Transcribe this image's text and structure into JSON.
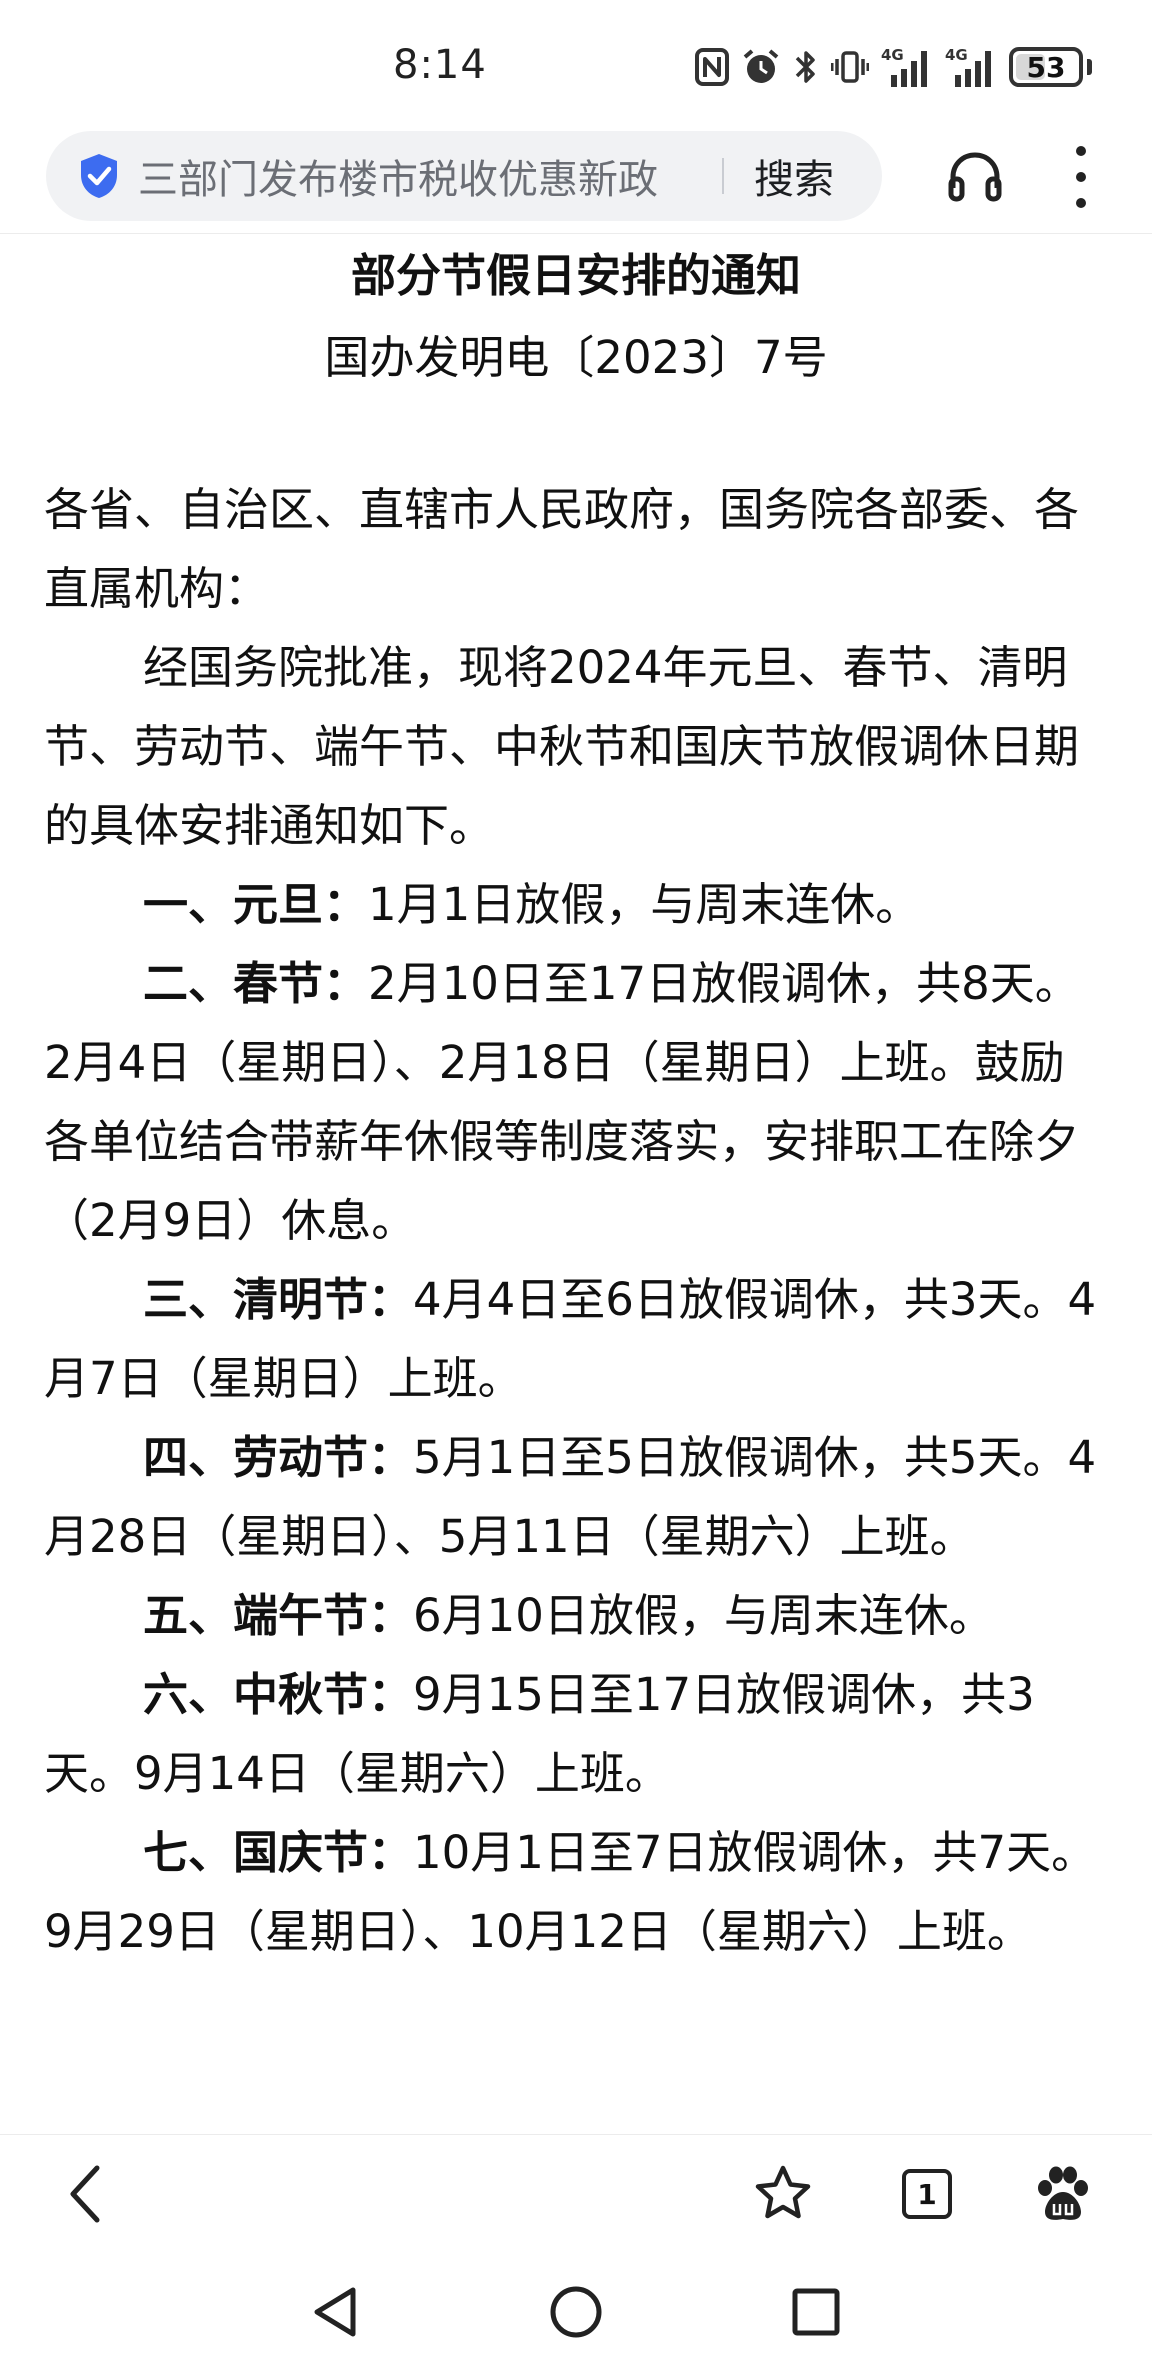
{
  "status_bar": {
    "time": "8:14",
    "network_label": "4G",
    "battery_level": "53"
  },
  "top_bar": {
    "search_query": "三部门发布楼市税收优惠新政",
    "search_button_label": "搜索"
  },
  "article": {
    "title": "部分节假日安排的通知",
    "doc_number": "国办发明电〔2023〕7号",
    "salutation": "各省、自治区、直辖市人民政府，国务院各部委、各直属机构：",
    "intro": "经国务院批准，现将2024年元旦、春节、清明节、劳动节、端午节、中秋节和国庆节放假调休日期的具体安排通知如下。",
    "items": [
      {
        "heading": "一、元旦：",
        "text": "1月1日放假，与周末连休。"
      },
      {
        "heading": "二、春节：",
        "text": "2月10日至17日放假调休，共8天。2月4日（星期日）、2月18日（星期日）上班。鼓励各单位结合带薪年休假等制度落实，安排职工在除夕（2月9日）休息。"
      },
      {
        "heading": "三、清明节：",
        "text": "4月4日至6日放假调休，共3天。4月7日（星期日）上班。"
      },
      {
        "heading": "四、劳动节：",
        "text": "5月1日至5日放假调休，共5天。4月28日（星期日）、5月11日（星期六）上班。"
      },
      {
        "heading": "五、端午节：",
        "text": "6月10日放假，与周末连休。"
      },
      {
        "heading": "六、中秋节：",
        "text": "9月15日至17日放假调休，共3天。9月14日（星期六）上班。"
      },
      {
        "heading": "七、国庆节：",
        "text": "10月1日至7日放假调休，共7天。9月29日（星期日）、10月12日（星期六）上班。"
      }
    ]
  },
  "bottom_toolbar": {
    "tab_count": "1"
  },
  "colors": {
    "shield_blue": "#3d6cf0",
    "text": "#111111",
    "search_bg": "#f1f2f4",
    "placeholder_gray": "#6b6e75"
  },
  "icons": {
    "status": [
      "nfc-icon",
      "alarm-icon",
      "bluetooth-icon",
      "vibrate-icon",
      "signal-icon",
      "battery-icon"
    ],
    "top_bar": [
      "shield-icon",
      "headphone-icon",
      "more-menu-icon"
    ],
    "bottom_toolbar": [
      "back-icon",
      "bookmark-star-icon",
      "tabs-icon",
      "baidu-paw-icon"
    ],
    "nav_bar": [
      "nav-back-icon",
      "nav-home-icon",
      "nav-recents-icon"
    ]
  }
}
